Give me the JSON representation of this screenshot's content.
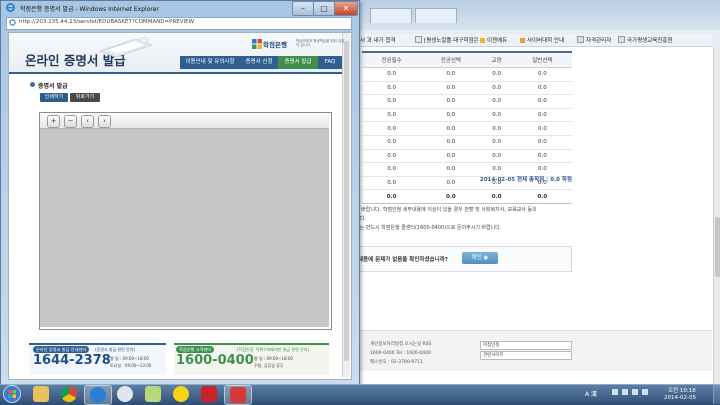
{
  "popup": {
    "title": "학점은행 증명서 발급 - Windows Internet Explorer",
    "address": "http://203.235.44.23/servlet/EDUBASKET?COMMAND=PREVIEW",
    "site_title": "온라인 증명서 발급",
    "logo": "학점은행",
    "logo_sub": "학습자에게 평생학습을 위한 길잡이 입니다",
    "nav": [
      "이용안내 및 유의사항",
      "증명서 신청",
      "증명서 발급",
      "FAQ"
    ],
    "section_title": "증명서 발급",
    "subtabs": {
      "print": "인쇄하기",
      "back": "뒤로가기"
    },
    "viewer_buttons": [
      "+",
      "−",
      "‹",
      "›"
    ],
    "contact": {
      "left_pill": "온라인 증명서 발급 안내센터",
      "left_note": "(증명서 발급 관련 문의)",
      "left_phone": "1644-2378",
      "left_hours_1": "평 일 : 09:00~18:00",
      "left_hours_2": "토요일 : 09:00~13:00",
      "right_pill": "학점은행 고객센터",
      "right_note": "(학점인정, 학위수여제외한 발급 관련 문의)",
      "right_phone": "1600-0400",
      "right_hours_1": "평 일 : 09:00~18:00",
      "right_hours_2": "주말, 공휴일 휴무"
    }
  },
  "background": {
    "favorites": [
      "서 과 내가 합격",
      "[평생노칼플-대구학점은",
      "이젠에듀",
      "사이버대학 안내",
      "자격관리자",
      "국가평생교육진흥원"
    ],
    "table": {
      "headers": [
        "전공필수",
        "전공선택",
        "교양",
        "일반선택"
      ],
      "rows": [
        [
          "0.0",
          "0.0",
          "0.0",
          "0.0"
        ],
        [
          "0.0",
          "0.0",
          "0.0",
          "0.0"
        ],
        [
          "0.0",
          "0.0",
          "0.0",
          "0.0"
        ],
        [
          "0.0",
          "0.0",
          "0.0",
          "0.0"
        ],
        [
          "0.0",
          "0.0",
          "0.0",
          "0.0"
        ],
        [
          "0.0",
          "0.0",
          "0.0",
          "0.0"
        ],
        [
          "0.0",
          "0.0",
          "0.0",
          "0.0"
        ],
        [
          "0.0",
          "0.0",
          "0.0",
          "0.0"
        ],
        [
          "0.0",
          "0.0",
          "0.0",
          "0.0"
        ]
      ],
      "total": [
        "0.0",
        "0.0",
        "0.0",
        "0.0"
      ]
    },
    "summary": "2014-02-05 현재 총학점 : 0.0 학점",
    "text_1": "니 바랍니다. 학점인정 세부내용에 이상이 있을 경우 관할 및 사회복지사, 보육교사 등의",
    "text_2": "니다.",
    "text_3": "에는 반드시 학점은행 콜센터(1600-0400)으로 문의주시기 바랍니다.",
    "notice": "내용에 문제가 없음을 확인하셨습니까?",
    "confirm_button": "확인",
    "footer_1": "개인정보처리방침    오시는길    RSS",
    "footer_2": "1600-0400    Tel : 1600-0400",
    "footer_3": "   팩스번호 : 02-3780-9711",
    "select_1": "학점인정",
    "select_2": "관련사이트"
  },
  "taskbar": {
    "lang": "A 漢",
    "time": "오전 10:18",
    "date": "2014-02-05"
  }
}
